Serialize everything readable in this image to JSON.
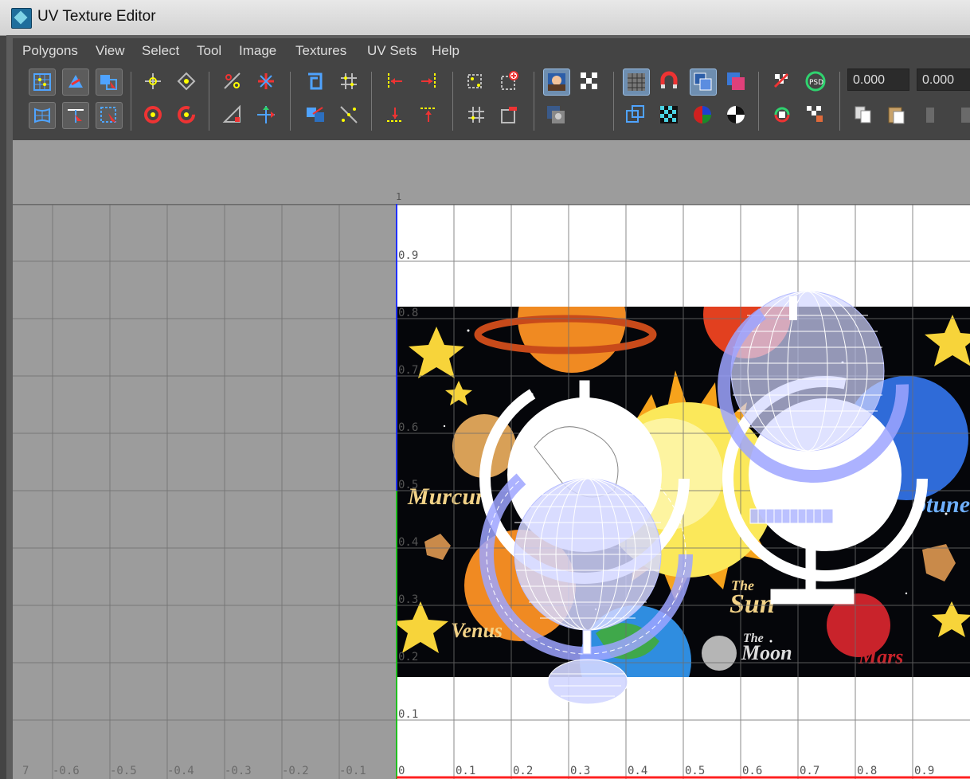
{
  "window": {
    "title": "UV Texture Editor"
  },
  "menu": [
    "Polygons",
    "View",
    "Select",
    "Tool",
    "Image",
    "Textures",
    "UV Sets",
    "Help"
  ],
  "fields": {
    "u_value": "0.000",
    "v_value": "0.000"
  },
  "grid": {
    "u_ticks": [
      "0",
      "0.1",
      "0.2",
      "0.3",
      "0.4",
      "0.5",
      "0.6",
      "0.7",
      "0.8",
      "0.9"
    ],
    "v_ticks": [
      "0.1",
      "0.2",
      "0.3",
      "0.4",
      "0.5",
      "0.6",
      "0.7",
      "0.8",
      "0.9"
    ],
    "neg_u_ticks": [
      "7",
      "-0.6",
      "-0.5",
      "-0.4",
      "-0.3",
      "-0.2",
      "-0.1"
    ],
    "top_marker": "1"
  },
  "texture_labels": {
    "mercury": "Murcur",
    "venus": "Venus",
    "the": "The",
    "sun": "Sun",
    "the2": "The",
    "moon": "Moon",
    "mars": "Mars",
    "neptune": "ptune"
  },
  "colors": {
    "u_axis": "#ff2020",
    "v_axis": "#20c020",
    "uv_wire": "#c8ccff",
    "toolbar_bg": "#444444",
    "viewport_bg": "#9c9c9c"
  }
}
